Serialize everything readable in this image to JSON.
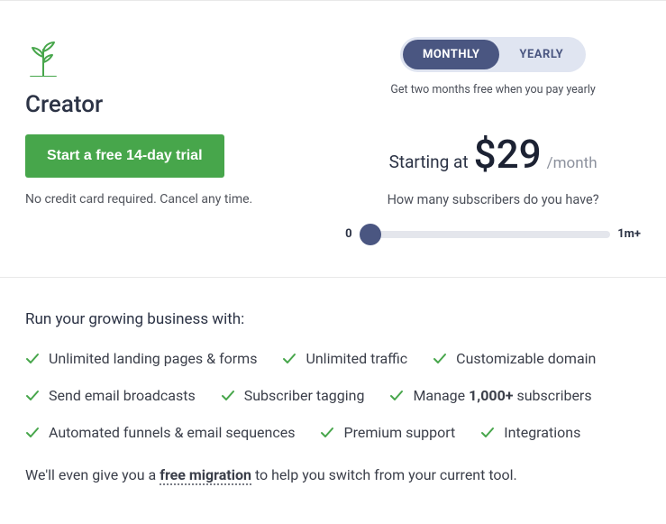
{
  "plan": {
    "title": "Creator",
    "cta_label": "Start a free 14-day trial",
    "disclaimer": "No credit card required. Cancel any time."
  },
  "billing": {
    "monthly_label": "MONTHLY",
    "yearly_label": "YEARLY",
    "yearly_note": "Get two months free when you pay yearly"
  },
  "pricing": {
    "prefix": "Starting at",
    "amount": "$29",
    "suffix": "/month",
    "subs_question": "How many subscribers do you have?",
    "slider_min_label": "0",
    "slider_max_label": "1m+"
  },
  "features": {
    "intro": "Run your growing business with:",
    "items": [
      "Unlimited landing pages & forms",
      "Unlimited traffic",
      "Customizable domain",
      "Send email broadcasts",
      "Subscriber tagging",
      "",
      "Automated funnels & email sequences",
      "Premium support",
      "Integrations"
    ],
    "manage_prefix": "Manage ",
    "manage_bold": "1,000+",
    "manage_suffix": " subscribers"
  },
  "migration": {
    "prefix": "We'll even give you a ",
    "link": "free migration",
    "suffix": " to help you switch from your current tool."
  }
}
